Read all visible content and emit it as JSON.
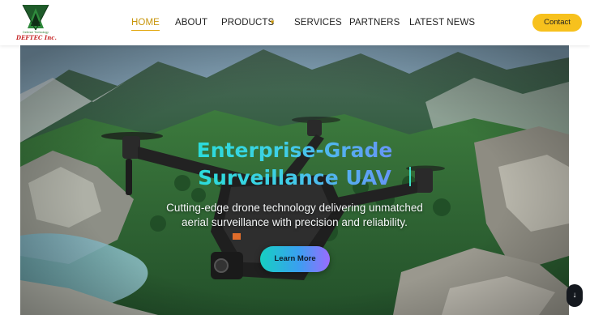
{
  "header": {
    "logo": {
      "tagline": "Defence Technology",
      "name": "DEFTEC Inc."
    },
    "nav": [
      {
        "label": "HOME",
        "active": true
      },
      {
        "label": "ABOUT"
      },
      {
        "label": "PRODUCTS",
        "has_dropdown": true
      },
      {
        "label": "SERVICES"
      },
      {
        "label": "PARTNERS"
      },
      {
        "label": "LATEST NEWS"
      }
    ],
    "contact_label": "Contact"
  },
  "hero": {
    "title": "Enterprise-Grade Surveillance UAV",
    "subtitle": "Cutting-edge drone technology delivering unmatched aerial surveillance with precision and reliability.",
    "cta_label": "Learn More"
  },
  "scroll_button_glyph": "↓",
  "colors": {
    "accent": "#f7c11d",
    "nav_active": "#c8960c",
    "title_gradient_start": "#1ee3d2",
    "title_gradient_end": "#7a78ff"
  }
}
